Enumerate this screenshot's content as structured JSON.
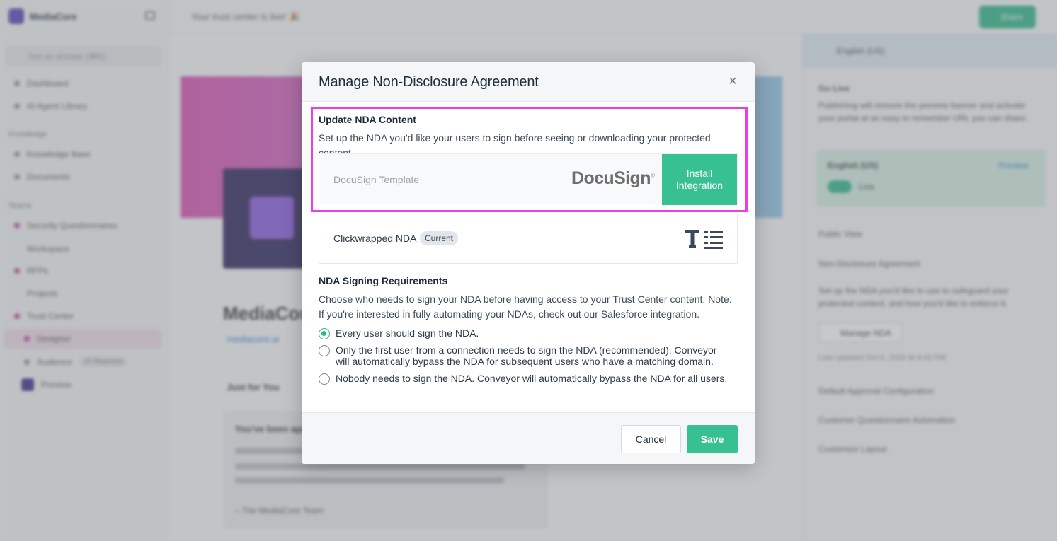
{
  "background": {
    "org_name": "MediaCore",
    "search_placeholder": "Get an answer (⌘K)",
    "topbar_message": "Your trust center is live! 🎉",
    "topbar_button": "Share",
    "sidebar": {
      "items": [
        {
          "label": "Dashboard"
        },
        {
          "label": "AI Agent Library"
        }
      ],
      "knowledge_section": "Knowledge",
      "knowledge_items": [
        {
          "label": "Knowledge Base"
        },
        {
          "label": "Documents"
        }
      ],
      "teams_section": "Teams",
      "team_items": [
        {
          "label": "Security Questionnaires"
        },
        {
          "label": "Workspace"
        },
        {
          "label": "RFPs"
        },
        {
          "label": "Projects"
        },
        {
          "label": "Trust Center"
        },
        {
          "label": "Designer"
        },
        {
          "label": "Audience",
          "badge": "10 Requests"
        },
        {
          "label": "Preview"
        }
      ]
    },
    "main": {
      "title": "MediaCore",
      "link": "mediacore.ai",
      "section": "Just for You",
      "card_title": "You've been approved",
      "card_signoff": "– The MediaCore Team"
    },
    "right_panel": {
      "language": "English (US)",
      "go_live_title": "Go Live",
      "go_live_desc": "Publishing will remove the preview banner and activate your portal at an easy to remember URL you can share.",
      "lang_card_label": "English (US)",
      "preview_link": "Preview",
      "live_label": "Live",
      "public_view": "Public View",
      "nda_heading": "Non-Disclosure Agreement",
      "nda_desc": "Set up the NDA you'd like to use to safeguard your protected content, and how you'd like to enforce it.",
      "manage_nda": "Manage NDA",
      "last_updated": "Last updated Oct 6, 2025 at 9:42 PM",
      "sections": [
        "Default Approval Configuration",
        "Customer Questionnaire Automation",
        "Customize Layout"
      ]
    }
  },
  "modal": {
    "title": "Manage Non-Disclosure Agreement",
    "close_label": "×",
    "content_section": {
      "title": "Update NDA Content",
      "description": "Set up the NDA you'd like your users to sign before seeing or downloading your protected content."
    },
    "docusign": {
      "label": "DocuSign Template",
      "logo_text": "DocuSign",
      "logo_mark": "®",
      "install_button": "Install Integration"
    },
    "clickwrapped": {
      "label": "Clickwrapped NDA",
      "badge": "Current"
    },
    "requirements": {
      "title": "NDA Signing Requirements",
      "description": "Choose who needs to sign your NDA before having access to your Trust Center content. Note: If you're interested in fully automating your NDAs, check out our Salesforce integration.",
      "options": [
        {
          "label": "Every user should sign the NDA.",
          "checked": true
        },
        {
          "label": "Only the first user from a connection needs to sign the NDA (recommended). Conveyor will automatically bypass the NDA for subsequent users who have a matching domain.",
          "checked": false
        },
        {
          "label": "Nobody needs to sign the NDA. Conveyor will automatically bypass the NDA for all users.",
          "checked": false
        }
      ]
    },
    "footer": {
      "cancel": "Cancel",
      "save": "Save"
    }
  },
  "colors": {
    "accent": "#37c091",
    "highlight": "#ea3ee8",
    "header_bg": "#f4f6f8"
  }
}
